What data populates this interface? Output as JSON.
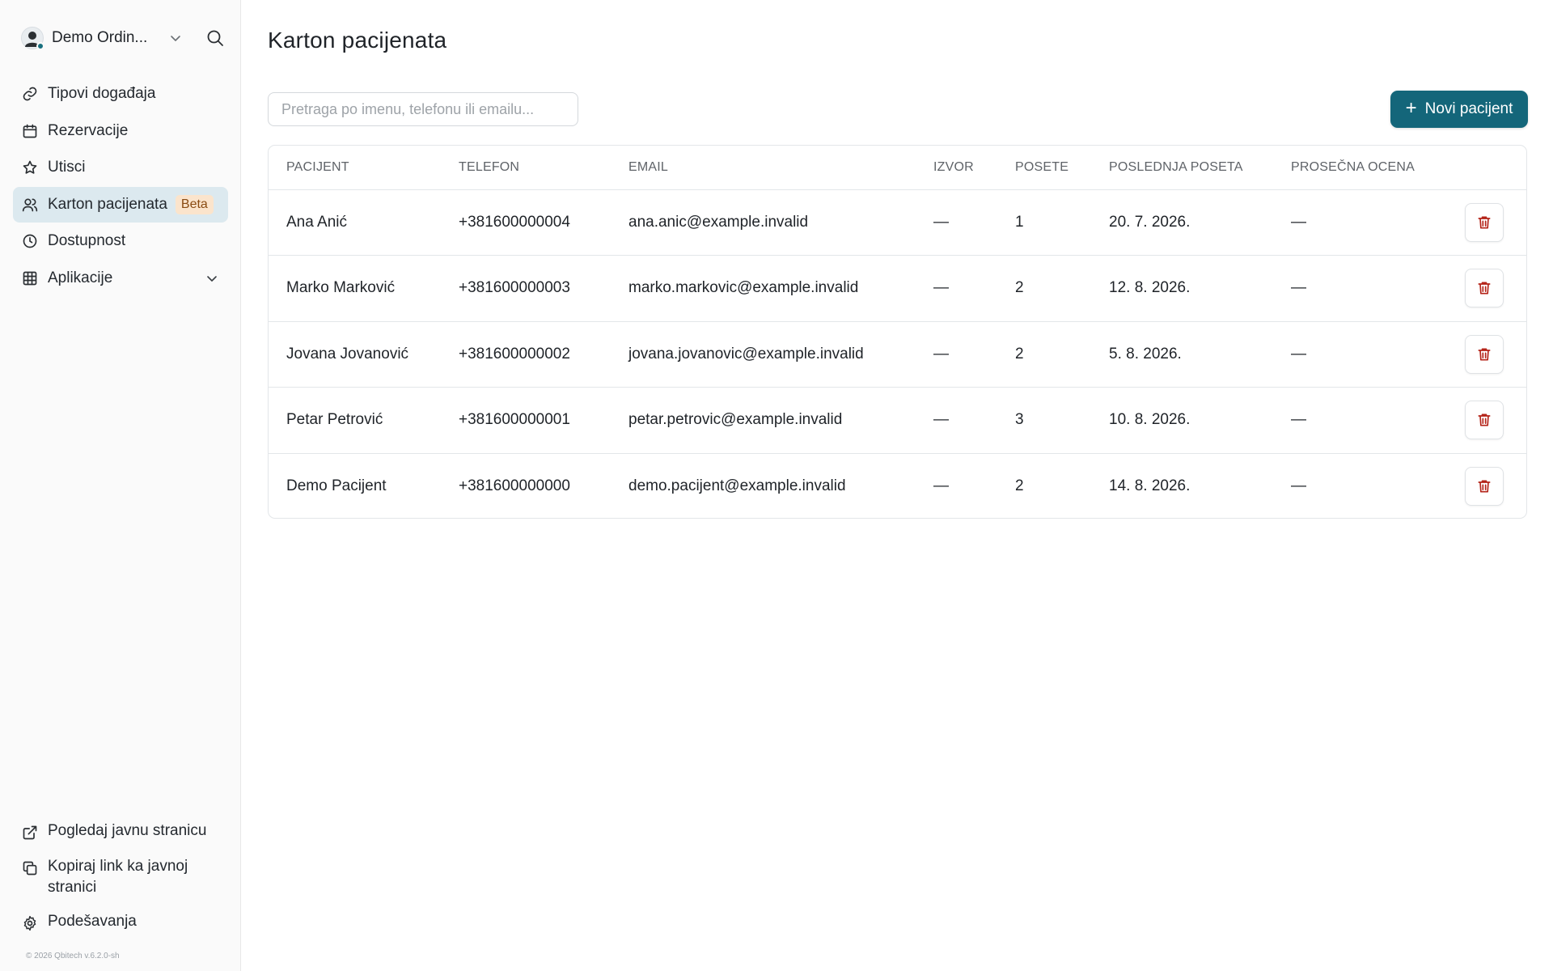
{
  "sidebar": {
    "account_name": "Demo Ordin...",
    "items": [
      {
        "label": "Tipovi događaja",
        "icon": "link-icon"
      },
      {
        "label": "Rezervacije",
        "icon": "calendar-icon"
      },
      {
        "label": "Utisci",
        "icon": "star-icon"
      },
      {
        "label": "Karton pacijenata",
        "icon": "users-icon",
        "badge": "Beta",
        "active": true
      },
      {
        "label": "Dostupnost",
        "icon": "clock-icon"
      },
      {
        "label": "Aplikacije",
        "icon": "grid-icon"
      }
    ],
    "bottom_items": [
      {
        "label": "Pogledaj javnu stranicu",
        "icon": "external-link-icon"
      },
      {
        "label": "Kopiraj link ka javnoj stranici",
        "icon": "copy-icon"
      },
      {
        "label": "Podešavanja",
        "icon": "gear-icon"
      }
    ],
    "footer": "© 2026 Qbitech v.6.2.0-sh"
  },
  "main": {
    "title": "Karton pacijenata",
    "search_placeholder": "Pretraga po imenu, telefonu ili emailu...",
    "new_button": "Novi pacijent",
    "table": {
      "columns": [
        "PACIJENT",
        "TELEFON",
        "EMAIL",
        "IZVOR",
        "POSETE",
        "POSLEDNJA POSETA",
        "PROSEČNA OCENA"
      ],
      "rows": [
        {
          "name": "Ana Anić",
          "phone": "+381600000004",
          "email": "ana.anic@example.invalid",
          "source": "—",
          "visits": "1",
          "last_visit": "20. 7. 2026.",
          "rating": "—"
        },
        {
          "name": "Marko Marković",
          "phone": "+381600000003",
          "email": "marko.markovic@example.invalid",
          "source": "—",
          "visits": "2",
          "last_visit": "12. 8. 2026.",
          "rating": "—"
        },
        {
          "name": "Jovana Jovanović",
          "phone": "+381600000002",
          "email": "jovana.jovanovic@example.invalid",
          "source": "—",
          "visits": "2",
          "last_visit": "5. 8. 2026.",
          "rating": "—"
        },
        {
          "name": "Petar Petrović",
          "phone": "+381600000001",
          "email": "petar.petrovic@example.invalid",
          "source": "—",
          "visits": "3",
          "last_visit": "10. 8. 2026.",
          "rating": "—"
        },
        {
          "name": "Demo Pacijent",
          "phone": "+381600000000",
          "email": "demo.pacijent@example.invalid",
          "source": "—",
          "visits": "2",
          "last_visit": "14. 8. 2026.",
          "rating": "—"
        }
      ]
    }
  },
  "colors": {
    "accent": "#14667a",
    "active_nav_bg": "#dce9ef",
    "badge_bg": "#fbe4cc",
    "delete_icon": "#b42318"
  }
}
